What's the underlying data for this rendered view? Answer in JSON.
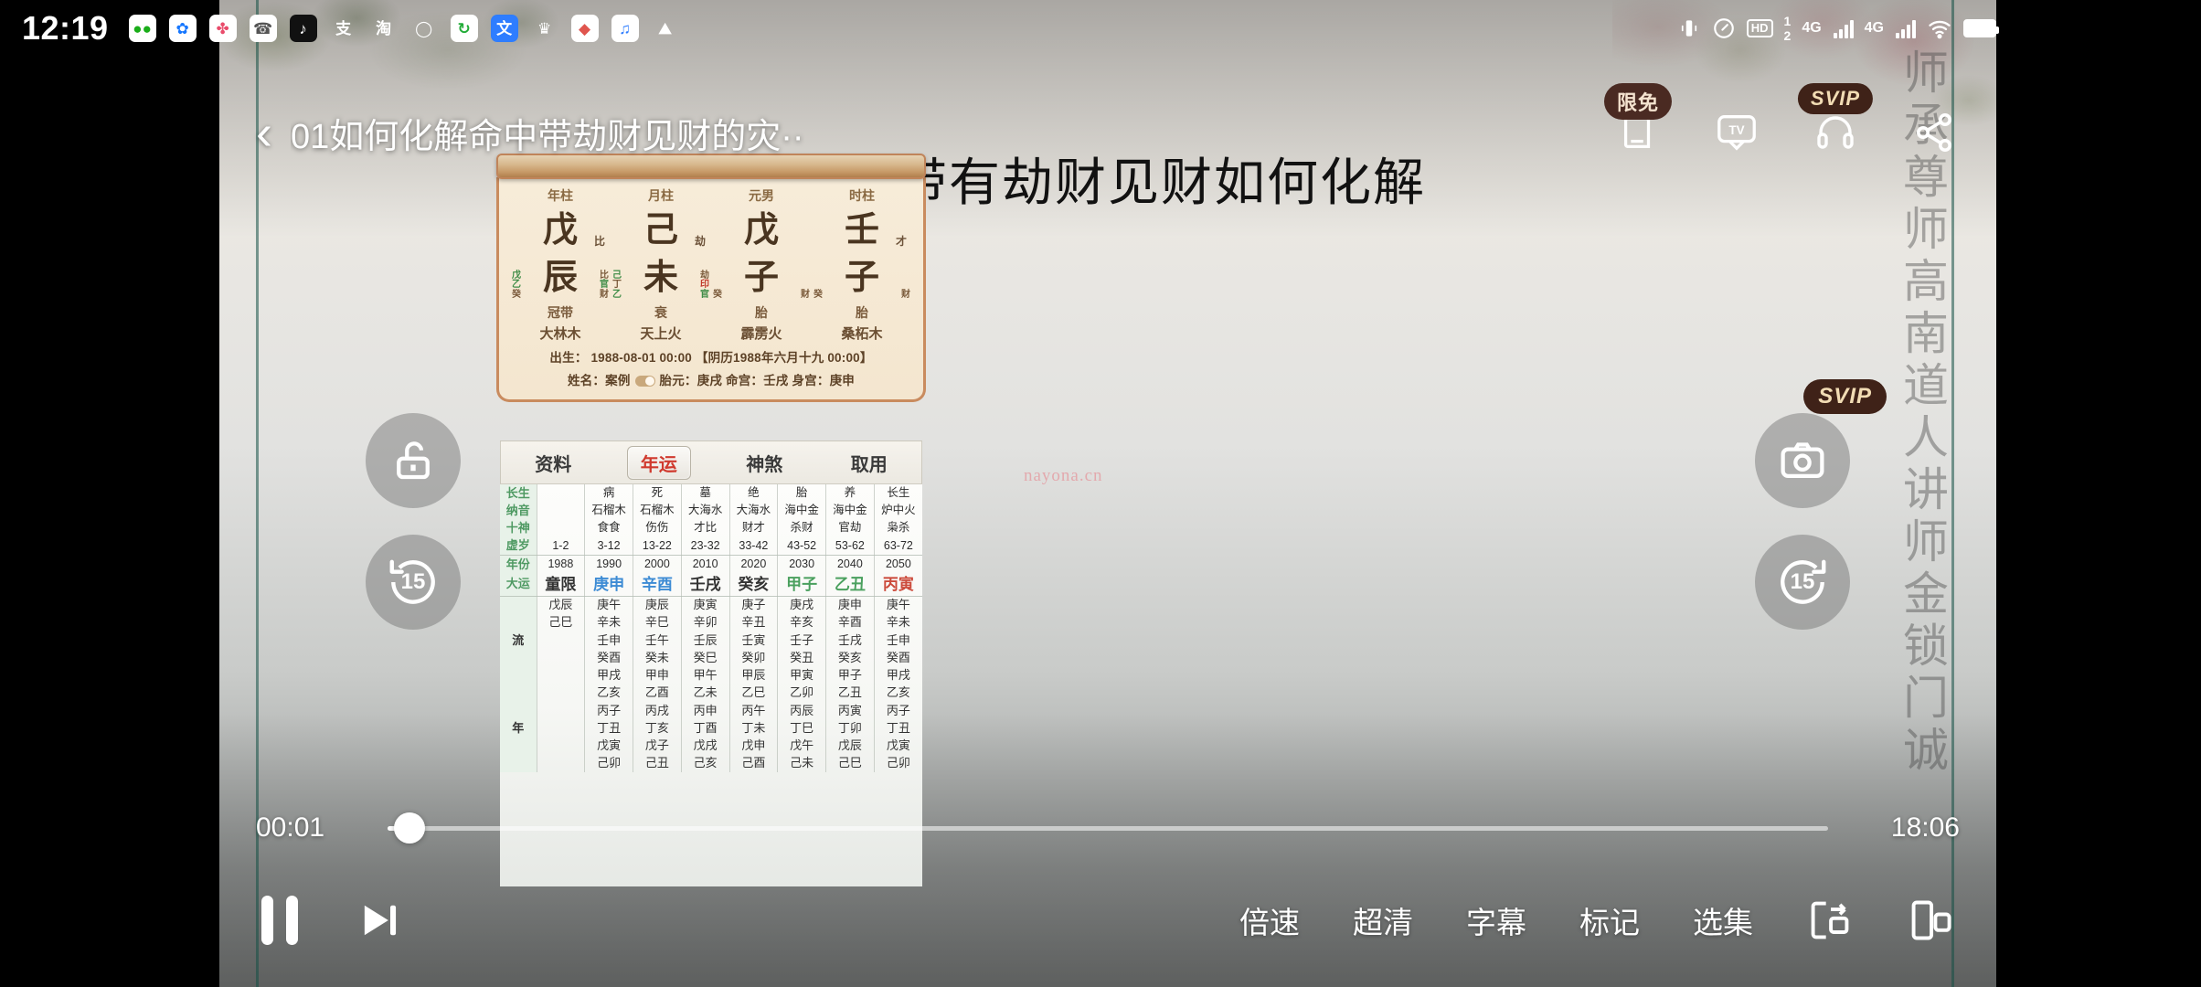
{
  "statusbar": {
    "clock": "12:19",
    "apps": [
      {
        "name": "wechat-icon",
        "glyph": "◕",
        "bg": "#ffffff",
        "fg": "#1aad19"
      },
      {
        "name": "alipay-treasure-icon",
        "glyph": "✿",
        "bg": "#ffffff",
        "fg": "#1677ff"
      },
      {
        "name": "app-icon-3",
        "glyph": "✤",
        "bg": "#ffffff",
        "fg": "#e94b6b"
      },
      {
        "name": "mail-icon",
        "glyph": "✉",
        "bg": "#ffffff",
        "fg": "#555555"
      },
      {
        "name": "tiktok-icon",
        "glyph": "♪",
        "bg": "#111111",
        "fg": "#ffffff"
      },
      {
        "name": "alipay-icon",
        "glyph": "支",
        "bg": "transparent",
        "fg": "#ffffff"
      },
      {
        "name": "taobao-icon",
        "glyph": "淘",
        "bg": "transparent",
        "fg": "#ffffff"
      },
      {
        "name": "ring-icon",
        "glyph": "◯",
        "bg": "transparent",
        "fg": "#ffffff"
      },
      {
        "name": "recycle-icon",
        "glyph": "↻",
        "bg": "#ffffff",
        "fg": "#22ac38"
      },
      {
        "name": "sogou-input-icon",
        "glyph": "文",
        "bg": "#2e7dff",
        "fg": "#ffffff"
      },
      {
        "name": "crown-icon",
        "glyph": "♛",
        "bg": "transparent",
        "fg": "#ffffff"
      },
      {
        "name": "app-icon-12",
        "glyph": "◆",
        "bg": "#ffffff",
        "fg": "#e0554e"
      },
      {
        "name": "music-icon",
        "glyph": "♫",
        "bg": "#ffffff",
        "fg": "#2e7dff"
      },
      {
        "name": "photos-icon",
        "glyph": "⛰",
        "bg": "transparent",
        "fg": "#ffffff"
      }
    ],
    "hd_label": "HD",
    "hd_sup": "1",
    "hd_sub": "2",
    "net1": "4G",
    "net2": "4G"
  },
  "player": {
    "back_icon": "chevron-left",
    "title": "01如何化解命中带劫财见财的灾··",
    "top_right": [
      {
        "name": "book-icon",
        "badge": "限免",
        "badge_type": "free"
      },
      {
        "name": "tv-cast-icon",
        "badge": "",
        "badge_type": ""
      },
      {
        "name": "headphone-audio-icon",
        "badge": "SVIP",
        "badge_type": "svip"
      },
      {
        "name": "share-icon",
        "badge": "",
        "badge_type": ""
      }
    ],
    "current_time": "00:01",
    "duration": "18:06",
    "progress_percent": 1.5,
    "bottom_menu": [
      "倍速",
      "超清",
      "字幕",
      "标记",
      "选集"
    ],
    "skip_back_label": "15",
    "skip_fwd_label": "15",
    "fwd_badge": "SVIP"
  },
  "content": {
    "headline": "命中带有劫财见财如何化解",
    "site_watermark": "nayona.cn",
    "vertical_watermark": "师承尊师高南道人讲师金锁门诚"
  },
  "bazi": {
    "pillar_labels": [
      "年柱",
      "月柱",
      "元男",
      "时柱"
    ],
    "heavenly_stems": [
      "戊",
      "己",
      "戊",
      "壬"
    ],
    "stem_gods": [
      "比",
      "劫",
      "",
      "才"
    ],
    "earthly_branches": [
      "辰",
      "未",
      "子",
      "子"
    ],
    "branch_hidden": [
      {
        "left": [
          "戊",
          "乙",
          "癸"
        ],
        "right": [
          "比",
          "官",
          "财"
        ]
      },
      {
        "left": [
          "己",
          "丁",
          "乙"
        ],
        "right": [
          "劫",
          "印",
          "官"
        ]
      },
      {
        "left": [
          "癸"
        ],
        "right": [
          "财"
        ]
      },
      {
        "left": [
          "癸"
        ],
        "right": [
          "财"
        ]
      }
    ],
    "twelve_stages": [
      "冠带",
      "衰",
      "胎",
      "胎"
    ],
    "nayin": [
      "大林木",
      "天上火",
      "霹雳火",
      "桑柘木"
    ],
    "birth_line": "出生： 1988-08-01 00:00  【阴历1988年六月十九 00:00】",
    "name_label": "姓名：",
    "name_value": "案例",
    "taiyuan_label": "胎元：",
    "taiyuan_value": "庚戌",
    "minggong_label": "命宫：",
    "minggong_value": "壬戌",
    "shengong_label": "身宫：",
    "shengong_value": "庚申",
    "tabs": [
      {
        "label": "资料",
        "active": false
      },
      {
        "label": "年运",
        "active": true
      },
      {
        "label": "神煞",
        "active": false
      },
      {
        "label": "取用",
        "active": false
      }
    ]
  },
  "luck_table": {
    "row_labels": [
      "长生",
      "纳音",
      "十神",
      "虚岁",
      "年份",
      "大运",
      "流",
      "年"
    ],
    "changsheng": [
      "",
      "病",
      "死",
      "墓",
      "绝",
      "胎",
      "养",
      "长生"
    ],
    "nayin": [
      "",
      "石榴木",
      "石榴木",
      "大海水",
      "大海水",
      "海中金",
      "海中金",
      "炉中火"
    ],
    "shishen": [
      "",
      "食食",
      "伤伤",
      "才比",
      "财才",
      "杀财",
      "官劫",
      "枭杀"
    ],
    "xusui": [
      "1-2",
      "3-12",
      "13-22",
      "23-32",
      "33-42",
      "43-52",
      "53-62",
      "63-72"
    ],
    "years": [
      "1988",
      "1990",
      "2000",
      "2010",
      "2020",
      "2030",
      "2040",
      "2050"
    ],
    "dayun": [
      {
        "text": "童限",
        "color": "dark"
      },
      {
        "text": "庚申",
        "color": "blue"
      },
      {
        "text": "辛酉",
        "color": "blue"
      },
      {
        "text": "壬戌",
        "color": "dark"
      },
      {
        "text": "癸亥",
        "color": "dark"
      },
      {
        "text": "甲子",
        "color": "green"
      },
      {
        "text": "乙丑",
        "color": "green"
      },
      {
        "text": "丙寅",
        "color": "red"
      }
    ],
    "liunian_rows": [
      [
        "戊辰",
        "庚午",
        "庚辰",
        "庚寅",
        "庚子",
        "庚戌",
        "庚申",
        "庚午"
      ],
      [
        "己巳",
        "辛未",
        "辛巳",
        "辛卯",
        "辛丑",
        "辛亥",
        "辛酉",
        "辛未"
      ],
      [
        "",
        "壬申",
        "壬午",
        "壬辰",
        "壬寅",
        "壬子",
        "壬戌",
        "壬申"
      ],
      [
        "",
        "癸酉",
        "癸未",
        "癸巳",
        "癸卯",
        "癸丑",
        "癸亥",
        "癸酉"
      ],
      [
        "",
        "甲戌",
        "甲申",
        "甲午",
        "甲辰",
        "甲寅",
        "甲子",
        "甲戌"
      ],
      [
        "",
        "乙亥",
        "乙酉",
        "乙未",
        "乙巳",
        "乙卯",
        "乙丑",
        "乙亥"
      ],
      [
        "",
        "丙子",
        "丙戌",
        "丙申",
        "丙午",
        "丙辰",
        "丙寅",
        "丙子"
      ],
      [
        "",
        "丁丑",
        "丁亥",
        "丁酉",
        "丁未",
        "丁巳",
        "丁卯",
        "丁丑"
      ],
      [
        "",
        "戊寅",
        "戊子",
        "戊戌",
        "戊申",
        "戊午",
        "戊辰",
        "戊寅"
      ],
      [
        "",
        "己卯",
        "己丑",
        "己亥",
        "己酉",
        "己未",
        "己巳",
        "己卯"
      ]
    ],
    "liu_label": "流",
    "nian_label": "年"
  },
  "colors": {
    "badge_brown": "#3f2218",
    "badge_text": "#f2dcb4",
    "tab_active": "#d03a2e",
    "accent_green": "#4f9a63",
    "watermark_pink": "#e3a9ad"
  }
}
